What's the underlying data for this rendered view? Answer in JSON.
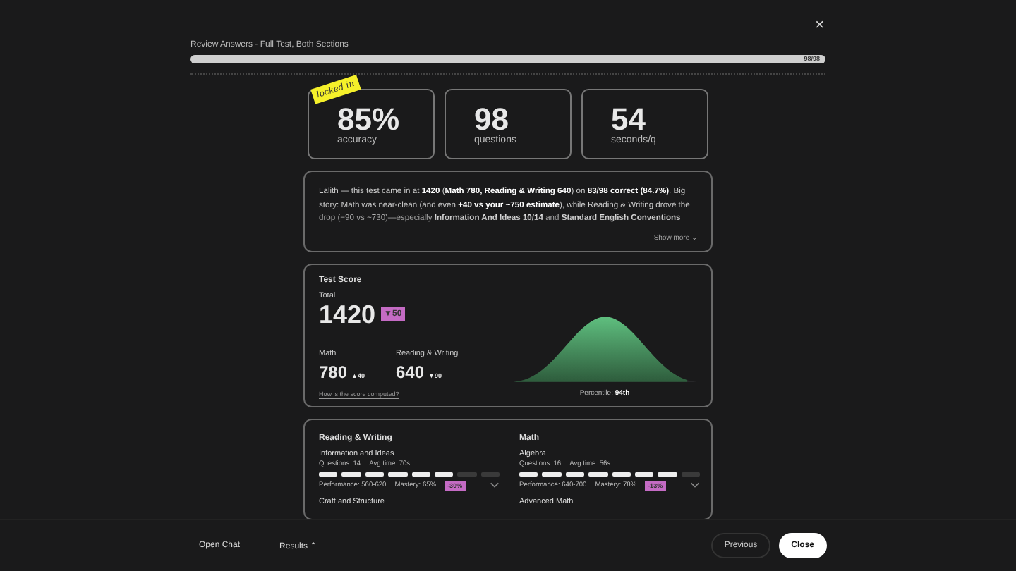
{
  "close_label": "×",
  "header": {
    "title": "Review Answers - Full Test, Both Sections",
    "progress": {
      "level": 1,
      "label": "98/98"
    }
  },
  "stats": [
    {
      "value": "85%",
      "label": "accuracy",
      "sticker": "locked in"
    },
    {
      "value": "98",
      "label": "questions"
    },
    {
      "value": "54",
      "label": "seconds/q"
    }
  ],
  "summary": {
    "text": "Lalith — this test came in at **1420** (**Math 780, Reading & Writing 640**) on **83/98 correct (84.7%)**. Big story: Math was near-clean (and even **+40 vs your ~750 estimate**), while Reading & Writing drove the drop (−90 vs ~730)—especially **Information And Ideas 10/14** and **Standard English Conventions**",
    "show_more": "Show more ⌄"
  },
  "test_score": {
    "title": "Test Score",
    "total_label": "Total",
    "total": "1420",
    "total_delta": "▼50",
    "sections": [
      {
        "name": "Math",
        "score": "780",
        "delta": "▲40"
      },
      {
        "name": "Reading & Writing",
        "score": "640",
        "delta": "▼90"
      }
    ],
    "link": "How is the score computed?",
    "percentile_label": "Percentile:",
    "percentile": "94th",
    "curve": {
      "level": 0.94
    }
  },
  "domains": [
    {
      "title": "Reading & Writing",
      "skills": [
        {
          "name": "Information and Ideas",
          "questions": "Questions: 14",
          "avg_time": "Avg time: 70s",
          "level": 0.75,
          "performance": "Performance: 560-620",
          "mastery": "Mastery: 65%",
          "change": "-30%"
        },
        {
          "name": "Craft and Structure"
        }
      ]
    },
    {
      "title": "Math",
      "skills": [
        {
          "name": "Algebra",
          "questions": "Questions: 16",
          "avg_time": "Avg time: 56s",
          "level": 0.875,
          "performance": "Performance: 640-700",
          "mastery": "Mastery: 78%",
          "change": "-13%"
        },
        {
          "name": "Advanced Math"
        }
      ]
    }
  ],
  "footer": {
    "left": [
      "Open Chat",
      "Results ⌃"
    ],
    "previous": "Previous",
    "close": "Close"
  }
}
